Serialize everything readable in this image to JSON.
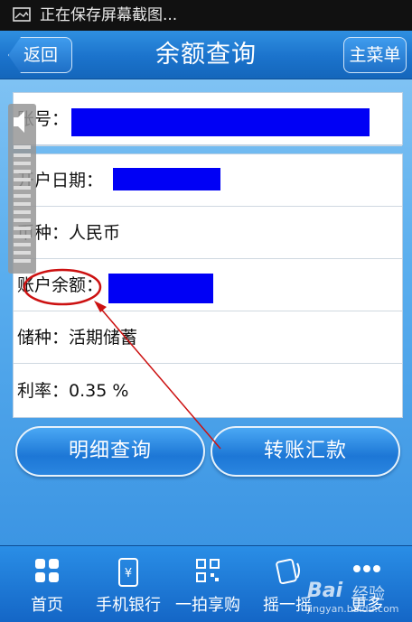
{
  "status_bar": {
    "text": "正在保存屏幕截图..."
  },
  "header": {
    "back_label": "返回",
    "title": "余额查询",
    "menu_label": "主菜单"
  },
  "account": {
    "label": "账号："
  },
  "details": {
    "open_date_label": "开户日期：",
    "currency_label": "币种：人民币",
    "balance_label": "账户余额：",
    "deposit_type_label": "储种：活期储蓄",
    "rate_label": "利率：0.35 %"
  },
  "actions": {
    "detail_query": "明细查询",
    "transfer": "转账汇款"
  },
  "bottom_nav": {
    "items": [
      {
        "label": "首页",
        "icon": "grid-icon"
      },
      {
        "label": "手机银行",
        "icon": "phone-bank-icon"
      },
      {
        "label": "一拍享购",
        "icon": "qr-code-icon"
      },
      {
        "label": "摇一摇",
        "icon": "shake-icon"
      },
      {
        "label": "更多",
        "icon": "more-dots-icon"
      }
    ]
  },
  "watermark": {
    "brand": "Bai",
    "brand_suffix": "经验",
    "url": "jingyan.baidu.com"
  },
  "colors": {
    "redaction": "#0000f5",
    "annotation": "#cc1111",
    "header": "#1b73cc"
  }
}
